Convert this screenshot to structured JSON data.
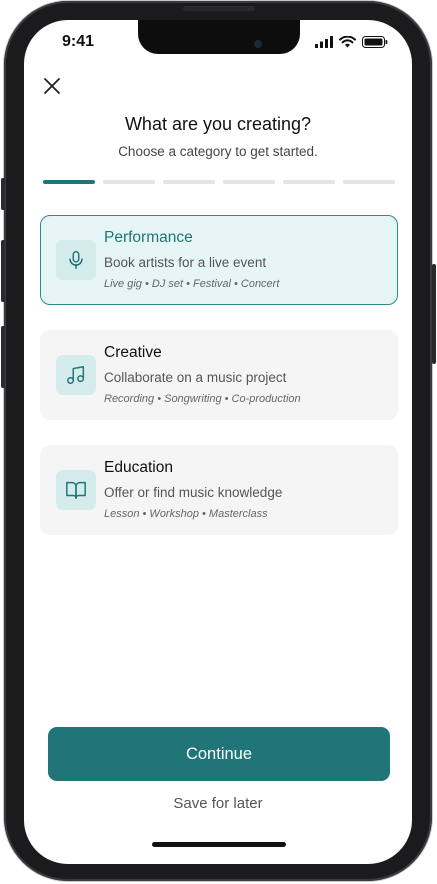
{
  "status": {
    "time": "9:41"
  },
  "header": {
    "title": "What are you creating?",
    "subtitle": "Choose a category to get started."
  },
  "progress": {
    "total_steps": 6,
    "current_step": 1
  },
  "categories": [
    {
      "title": "Performance",
      "description": "Book artists for a live event",
      "tags": "Live gig • DJ set • Festival • Concert",
      "icon": "microphone-icon",
      "selected": true
    },
    {
      "title": "Creative",
      "description": "Collaborate on a music project",
      "tags": "Recording • Songwriting • Co-production",
      "icon": "music-note-icon",
      "selected": false
    },
    {
      "title": "Education",
      "description": "Offer or find music knowledge",
      "tags": "Lesson • Workshop • Masterclass",
      "icon": "open-book-icon",
      "selected": false
    }
  ],
  "actions": {
    "continue_label": "Continue",
    "save_later_label": "Save for later"
  },
  "colors": {
    "accent": "#1f7577",
    "selected_card_bg": "#e6f5f5",
    "card_bg": "#f5f5f5",
    "icon_bg": "#d4ecec"
  }
}
